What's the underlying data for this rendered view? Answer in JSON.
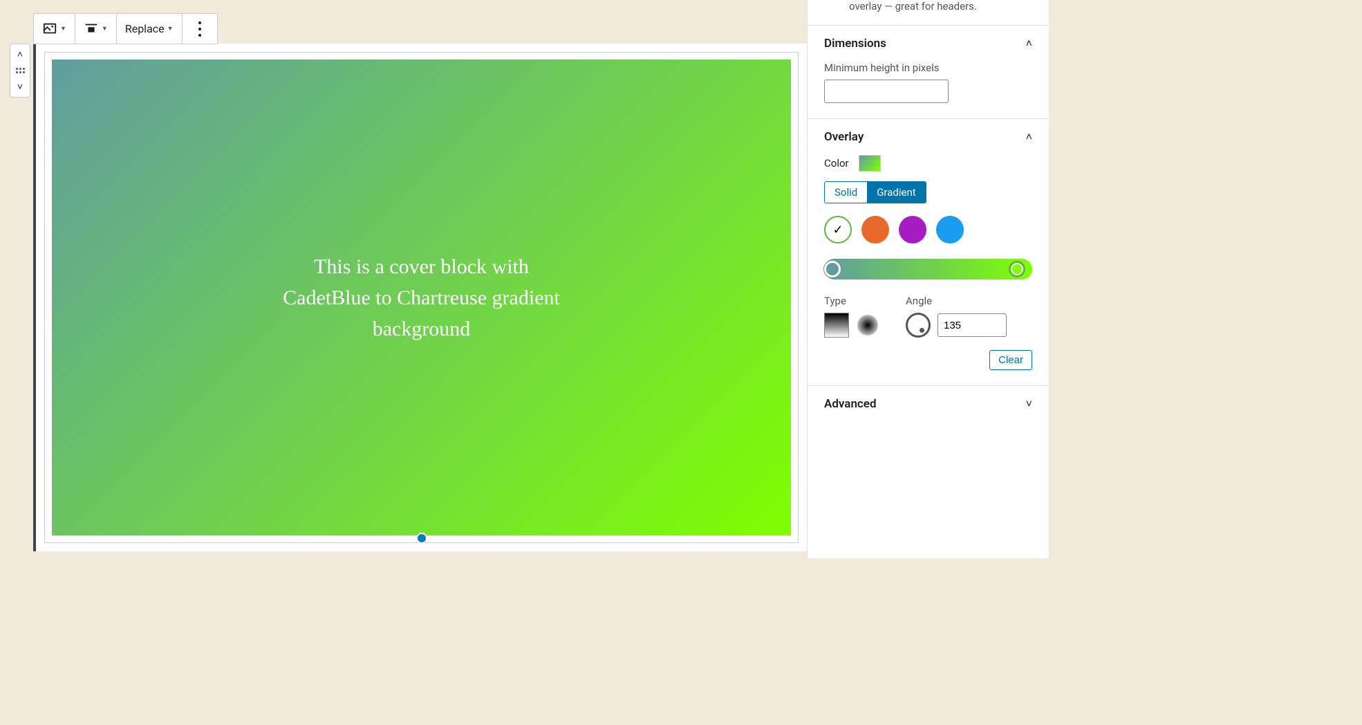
{
  "toolbar": {
    "replace_label": "Replace"
  },
  "cover": {
    "text": "This is a cover block with CadetBlue to Chartreuse gradient background",
    "gradient_start": "#5f9ea0",
    "gradient_end": "#7fff00",
    "gradient_angle": 135
  },
  "sidebar": {
    "intro_tail": "overlay — great for headers.",
    "dimensions": {
      "title": "Dimensions",
      "min_height_label": "Minimum height in pixels",
      "min_height_value": ""
    },
    "overlay": {
      "title": "Overlay",
      "color_label": "Color",
      "solid_label": "Solid",
      "gradient_label": "Gradient",
      "active_mode": "Gradient",
      "presets": [
        "selected",
        "orange",
        "purple",
        "blue"
      ],
      "type_label": "Type",
      "angle_label": "Angle",
      "angle_value": "135",
      "clear_label": "Clear"
    },
    "advanced": {
      "title": "Advanced"
    }
  }
}
